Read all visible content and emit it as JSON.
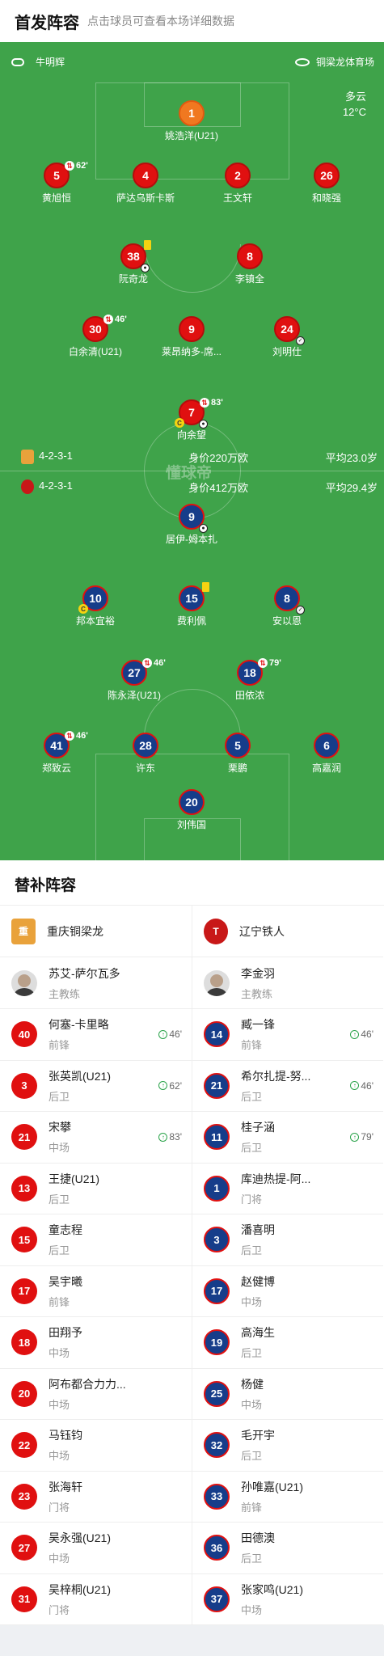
{
  "header": {
    "title": "首发阵容",
    "subtitle": "点击球员可查看本场详细数据"
  },
  "pitch": {
    "referee": "牛明辉",
    "venue": "铜梁龙体育场",
    "weather": "多云",
    "temperature": "12°C",
    "watermark": "懂球帝",
    "home_info": {
      "formation": "4-2-3-1",
      "value": "身价220万欧",
      "age": "平均23.0岁",
      "color": "#e01010"
    },
    "away_info": {
      "formation": "4-2-3-1",
      "value": "身价412万欧",
      "age": "平均29.4岁",
      "color": "#e01010"
    },
    "home_players": [
      {
        "num": "1",
        "name": "姚浩洋(U21)",
        "gk": true
      },
      {
        "num": "5",
        "name": "黄旭恒",
        "sub": "62'"
      },
      {
        "num": "4",
        "name": "萨达乌斯卡斯"
      },
      {
        "num": "2",
        "name": "王文轩"
      },
      {
        "num": "26",
        "name": "和晓强"
      },
      {
        "num": "38",
        "name": "阮奇龙",
        "yellow": true,
        "goal": true
      },
      {
        "num": "8",
        "name": "李镇全"
      },
      {
        "num": "30",
        "name": "白余清(U21)",
        "sub": "46'"
      },
      {
        "num": "9",
        "name": "莱昂纳多-席..."
      },
      {
        "num": "24",
        "name": "刘明仕",
        "assist": true
      },
      {
        "num": "7",
        "name": "向余望",
        "sub": "83'",
        "captain": true,
        "goal": true
      }
    ],
    "away_players": [
      {
        "num": "9",
        "name": "居伊-姆本扎",
        "goal": true
      },
      {
        "num": "10",
        "name": "邦本宜裕",
        "captain": true
      },
      {
        "num": "15",
        "name": "费利佩",
        "yellow": true
      },
      {
        "num": "8",
        "name": "安以恩",
        "assist": true
      },
      {
        "num": "27",
        "name": "陈永泽(U21)",
        "sub": "46'"
      },
      {
        "num": "18",
        "name": "田依浓",
        "sub": "79'"
      },
      {
        "num": "41",
        "name": "郑致云",
        "sub": "46'"
      },
      {
        "num": "28",
        "name": "许东"
      },
      {
        "num": "5",
        "name": "栗鹏"
      },
      {
        "num": "6",
        "name": "高嘉润"
      },
      {
        "num": "20",
        "name": "刘伟国"
      }
    ]
  },
  "subs": {
    "title": "替补阵容",
    "home": {
      "team": "重庆铜梁龙",
      "coach": "苏艾-萨尔瓦多",
      "coach_role": "主教练",
      "players": [
        {
          "num": "40",
          "name": "何塞-卡里略",
          "pos": "前锋",
          "sub": "46'"
        },
        {
          "num": "3",
          "name": "张英凯(U21)",
          "pos": "后卫",
          "sub": "62'"
        },
        {
          "num": "21",
          "name": "宋攀",
          "pos": "中场",
          "sub": "83'"
        },
        {
          "num": "13",
          "name": "王捷(U21)",
          "pos": "后卫"
        },
        {
          "num": "15",
          "name": "童志程",
          "pos": "后卫"
        },
        {
          "num": "17",
          "name": "吴宇曦",
          "pos": "前锋"
        },
        {
          "num": "18",
          "name": "田翔予",
          "pos": "中场"
        },
        {
          "num": "20",
          "name": "阿布都合力力...",
          "pos": "中场"
        },
        {
          "num": "22",
          "name": "马钰钧",
          "pos": "中场"
        },
        {
          "num": "23",
          "name": "张海轩",
          "pos": "门将"
        },
        {
          "num": "27",
          "name": "吴永强(U21)",
          "pos": "中场"
        },
        {
          "num": "31",
          "name": "吴梓桐(U21)",
          "pos": "门将"
        }
      ]
    },
    "away": {
      "team": "辽宁铁人",
      "coach": "李金羽",
      "coach_role": "主教练",
      "players": [
        {
          "num": "14",
          "name": "臧一锋",
          "pos": "前锋",
          "sub": "46'"
        },
        {
          "num": "21",
          "name": "希尔扎提-努...",
          "pos": "后卫",
          "sub": "46'"
        },
        {
          "num": "11",
          "name": "桂子涵",
          "pos": "后卫",
          "sub": "79'"
        },
        {
          "num": "1",
          "name": "库迪热提-阿...",
          "pos": "门将"
        },
        {
          "num": "3",
          "name": "潘喜明",
          "pos": "后卫"
        },
        {
          "num": "17",
          "name": "赵健博",
          "pos": "中场"
        },
        {
          "num": "19",
          "name": "高海生",
          "pos": "后卫"
        },
        {
          "num": "25",
          "name": "杨健",
          "pos": "中场"
        },
        {
          "num": "32",
          "name": "毛开宇",
          "pos": "后卫"
        },
        {
          "num": "33",
          "name": "孙唯嘉(U21)",
          "pos": "前锋"
        },
        {
          "num": "36",
          "name": "田德澳",
          "pos": "后卫"
        },
        {
          "num": "37",
          "name": "张家鸣(U21)",
          "pos": "中场"
        }
      ]
    }
  }
}
